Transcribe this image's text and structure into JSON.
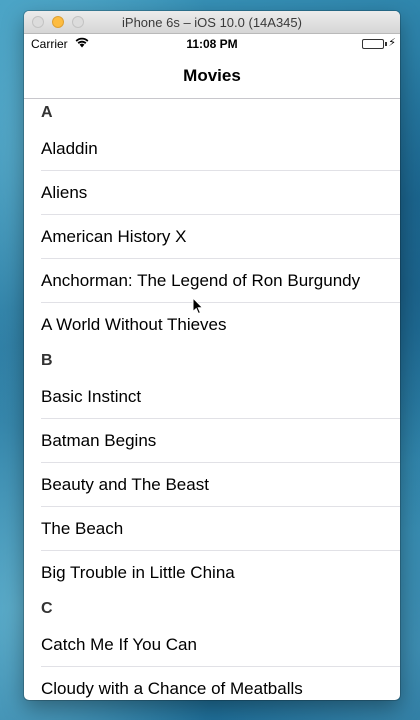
{
  "window": {
    "title": "iPhone 6s – iOS 10.0 (14A345)"
  },
  "status_bar": {
    "carrier": "Carrier",
    "time": "11:08 PM",
    "battery_level": 1.0,
    "battery_color": "#4cd964"
  },
  "nav": {
    "title": "Movies"
  },
  "sections": [
    {
      "letter": "A",
      "items": [
        "Aladdin",
        "Aliens",
        "American History X",
        "Anchorman: The Legend of Ron Burgundy",
        "A World Without Thieves"
      ]
    },
    {
      "letter": "B",
      "items": [
        "Basic Instinct",
        "Batman Begins",
        "Beauty and The Beast",
        "The Beach",
        "Big Trouble in Little China"
      ]
    },
    {
      "letter": "C",
      "items": [
        "Catch Me If You Can",
        "Cloudy with a Chance of Meatballs"
      ]
    }
  ]
}
